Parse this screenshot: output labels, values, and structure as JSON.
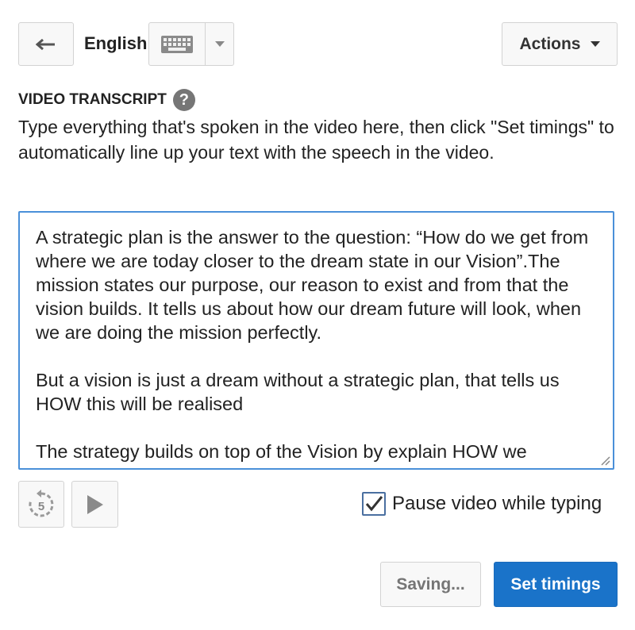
{
  "header": {
    "back_icon": "arrow-left-icon",
    "language": "English",
    "keyboard_icon": "keyboard-icon",
    "dropdown_icon": "caret-down-icon",
    "actions_label": "Actions"
  },
  "transcript": {
    "section_title": "VIDEO TRANSCRIPT",
    "help_icon": "?",
    "instructions": "Type everything that's spoken in the video here, then click \"Set timings\" to automatically line up your text with the speech in the video.",
    "text": "A strategic plan is the answer to the question: “How do we get from where we are today closer to the dream state in our Vision”.The mission states our purpose, our reason to exist and from that the vision builds. It tells us about how our dream future will look, when we are doing the mission perfectly.\n\nBut a vision is just a dream without a strategic plan, that tells us HOW this will be realised\n\nThe strategy builds on top of the Vision by explain HOW we"
  },
  "controls": {
    "rewind_icon": "rewind-5-seconds-icon",
    "rewind_seconds": "5",
    "play_icon": "play-icon",
    "pause_label": "Pause video while typing",
    "pause_checked": true
  },
  "footer": {
    "saving_label": "Saving...",
    "set_timings_label": "Set timings"
  },
  "colors": {
    "accent": "#1a73c9",
    "focus_border": "#4a90d9"
  }
}
